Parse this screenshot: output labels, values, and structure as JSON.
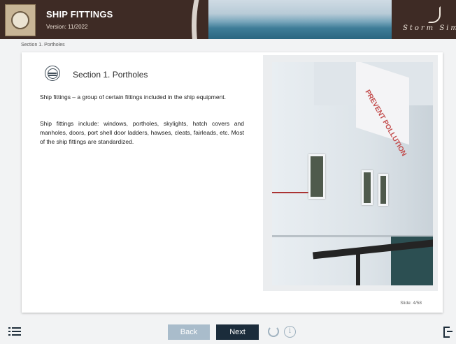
{
  "header": {
    "title": "SHIP FITTINGS",
    "version": "Version: 11/2022",
    "brand": "Storm Sim"
  },
  "breadcrumb": "Section 1. Portholes",
  "section": {
    "title": "Section 1. Portholes",
    "paragraphs": [
      "Ship fittings – a group of certain fittings included in the ship equipment.",
      "Ship fittings include: windows, portholes, skylights, hatch covers and manholes, doors, port shell door ladders, hawses, cleats, fairleads, etc. Most of the ship fittings are standardized."
    ]
  },
  "photo": {
    "banner_text": "PREVENT POLLUTION"
  },
  "slide_counter": "Slide: 4/58",
  "footer": {
    "back_label": "Back",
    "next_label": "Next",
    "info_glyph": "i"
  },
  "icons": [
    "menu-icon",
    "section-porthole-icon",
    "refresh-icon",
    "info-icon",
    "exit-icon",
    "logo-icon"
  ],
  "colors": {
    "header_bg": "#3e2b25",
    "next_bg": "#1b2c3b",
    "back_bg": "#a9bccb"
  }
}
